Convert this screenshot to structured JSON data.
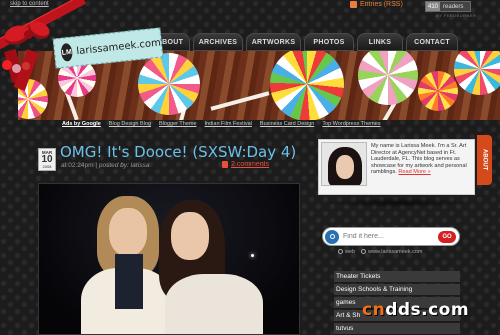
{
  "top": {
    "skip_link": "skip to content",
    "rss_label": "Entries (RSS)",
    "readers_count": "410",
    "readers_label": "readers",
    "readers_by": "BY FEEDBURNER"
  },
  "logo": {
    "mark": "LM",
    "text": "larissameek.com"
  },
  "nav": {
    "items": [
      "ABOUT",
      "ARCHIVES",
      "ARTWORKS",
      "PHOTOS",
      "LINKS",
      "CONTACT"
    ]
  },
  "linkbar": {
    "ads_label": "Ads by Google",
    "links": [
      "Blog Design Blog",
      "Blogger Theme",
      "Indian Film Festival",
      "Business Card Design",
      "Top Wordpress Themes"
    ]
  },
  "post": {
    "date_month": "MAR",
    "date_day": "10",
    "date_year": "2008",
    "title": "OMG! It's Dooce! (SXSW:Day 4)",
    "time": "at 02:24pm",
    "posted_by_label": "posted by:",
    "author": "larissa",
    "comments": "2 comments"
  },
  "about": {
    "tab_label": "ABOUT",
    "text": "My name is Larissa Meek. I'm a Sr. Art Director at AgencyNet based in Ft. Lauderdale, FL. This blog serves as showcase for my artwork and personal ramblings.",
    "more": "Read More »"
  },
  "search": {
    "placeholder": "Find it here...",
    "go_label": "GO",
    "opt_web": "web",
    "opt_site": "www.larissameek.com"
  },
  "ads": {
    "items": [
      "Theater Tickets",
      "Design Schools & Training",
      "games",
      "Art & Sh",
      "tutvus"
    ]
  },
  "watermark": {
    "cn": "cn",
    "rest": "dds.com"
  }
}
